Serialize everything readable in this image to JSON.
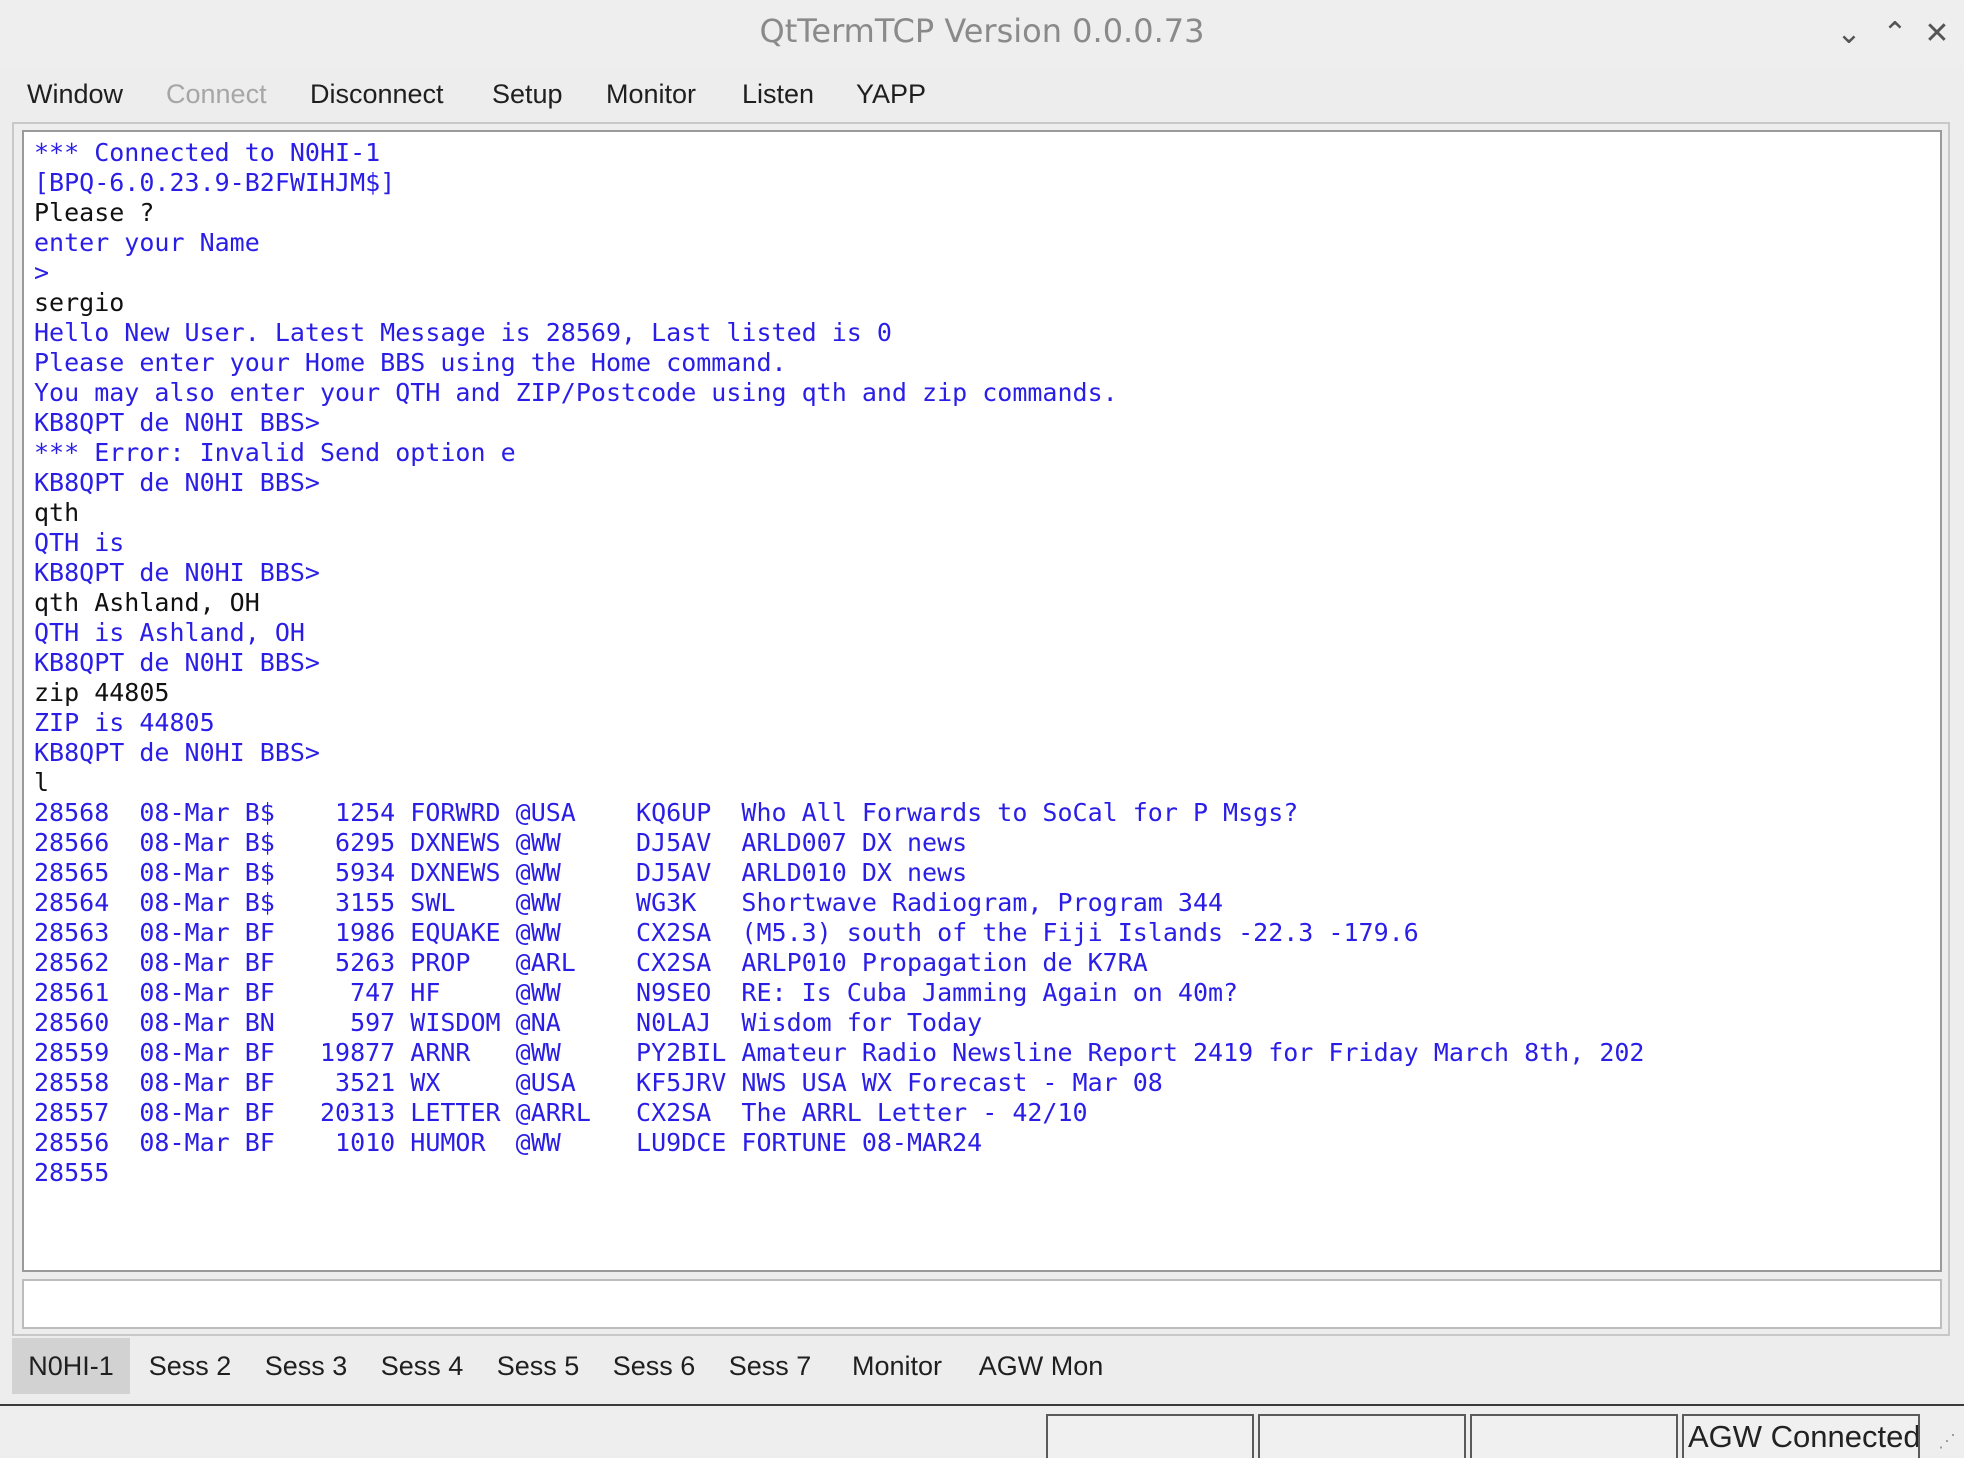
{
  "window": {
    "title": "QtTermTCP Version 0.0.0.73"
  },
  "menu": {
    "window": "Window",
    "connect": "Connect",
    "disconnect": "Disconnect",
    "setup": "Setup",
    "monitor": "Monitor",
    "listen": "Listen",
    "yapp": "YAPP"
  },
  "terminal": {
    "lines": [
      {
        "text": "*** Connected to N0HI-1",
        "color": "blue"
      },
      {
        "text": "[BPQ-6.0.23.9-B2FWIHJM$]",
        "color": "blue"
      },
      {
        "text": "Please ?",
        "color": "black"
      },
      {
        "text": "enter your Name",
        "color": "blue"
      },
      {
        "text": ">",
        "color": "blue"
      },
      {
        "text": "sergio",
        "color": "black"
      },
      {
        "text": "Hello New User. Latest Message is 28569, Last listed is 0",
        "color": "blue"
      },
      {
        "text": "Please enter your Home BBS using the Home command.",
        "color": "blue"
      },
      {
        "text": "You may also enter your QTH and ZIP/Postcode using qth and zip commands.",
        "color": "blue"
      },
      {
        "text": "KB8QPT de N0HI BBS>",
        "color": "blue"
      },
      {
        "text": "*** Error: Invalid Send option e",
        "color": "blue"
      },
      {
        "text": "KB8QPT de N0HI BBS>",
        "color": "blue"
      },
      {
        "text": "qth",
        "color": "black"
      },
      {
        "text": "QTH is",
        "color": "blue"
      },
      {
        "text": "KB8QPT de N0HI BBS>",
        "color": "blue"
      },
      {
        "text": "qth Ashland, OH",
        "color": "black"
      },
      {
        "text": "QTH is Ashland, OH",
        "color": "blue"
      },
      {
        "text": "KB8QPT de N0HI BBS>",
        "color": "blue"
      },
      {
        "text": "zip 44805",
        "color": "black"
      },
      {
        "text": "ZIP is 44805",
        "color": "blue"
      },
      {
        "text": "KB8QPT de N0HI BBS>",
        "color": "blue"
      },
      {
        "text": "l",
        "color": "black"
      },
      {
        "text": "28568  08-Mar B$    1254 FORWRD @USA    KQ6UP  Who All Forwards to SoCal for P Msgs?",
        "color": "blue"
      },
      {
        "text": "28566  08-Mar B$    6295 DXNEWS @WW     DJ5AV  ARLD007 DX news",
        "color": "blue"
      },
      {
        "text": "28565  08-Mar B$    5934 DXNEWS @WW     DJ5AV  ARLD010 DX news",
        "color": "blue"
      },
      {
        "text": "28564  08-Mar B$    3155 SWL    @WW     WG3K   Shortwave Radiogram, Program 344",
        "color": "blue"
      },
      {
        "text": "28563  08-Mar BF    1986 EQUAKE @WW     CX2SA  (M5.3) south of the Fiji Islands -22.3 -179.6",
        "color": "blue"
      },
      {
        "text": "28562  08-Mar BF    5263 PROP   @ARL    CX2SA  ARLP010 Propagation de K7RA",
        "color": "blue"
      },
      {
        "text": "28561  08-Mar BF     747 HF     @WW     N9SEO  RE: Is Cuba Jamming Again on 40m?",
        "color": "blue"
      },
      {
        "text": "28560  08-Mar BN     597 WISDOM @NA     N0LAJ  Wisdom for Today",
        "color": "blue"
      },
      {
        "text": "28559  08-Mar BF   19877 ARNR   @WW     PY2BIL Amateur Radio Newsline Report 2419 for Friday March 8th, 202",
        "color": "blue"
      },
      {
        "text": "28558  08-Mar BF    3521 WX     @USA    KF5JRV NWS USA WX Forecast - Mar 08",
        "color": "blue"
      },
      {
        "text": "28557  08-Mar BF   20313 LETTER @ARRL   CX2SA  The ARRL Letter - 42/10",
        "color": "blue"
      },
      {
        "text": "28556  08-Mar BF    1010 HUMOR  @WW     LU9DCE FORTUNE 08-MAR24",
        "color": "blue"
      },
      {
        "text": "28555",
        "color": "blue"
      }
    ]
  },
  "input": {
    "value": ""
  },
  "tabs": [
    "N0HI-1",
    "Sess 2",
    "Sess 3",
    "Sess 4",
    "Sess 5",
    "Sess 6",
    "Sess 7",
    "Monitor",
    "AGW Mon"
  ],
  "active_tab": "N0HI-1",
  "status": {
    "cell1": "",
    "cell2": "",
    "cell3": "",
    "agw": "AGW Connected"
  },
  "colors": {
    "blue": "#2a1ee6",
    "black": "#111111"
  }
}
